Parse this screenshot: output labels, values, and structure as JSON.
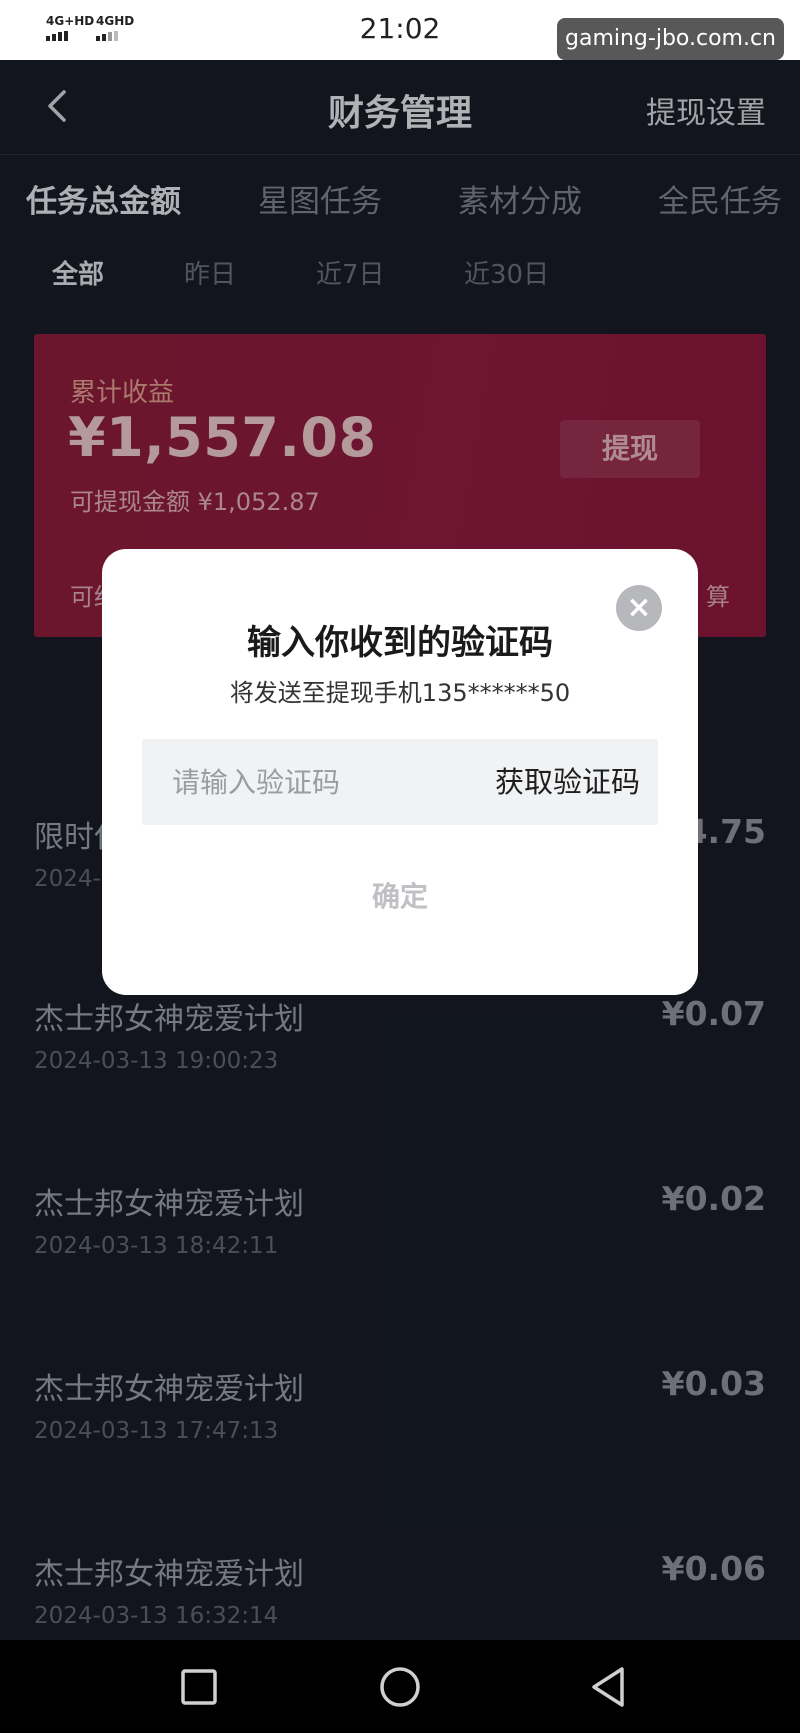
{
  "status_bar": {
    "signal_1": "4G+HD",
    "signal_2": "4GHD",
    "time": "21:02",
    "watermark": "gaming-jbo.com.cn"
  },
  "nav": {
    "title": "财务管理",
    "right_action": "提现设置"
  },
  "tabs": [
    {
      "label": "任务总金额",
      "active": true
    },
    {
      "label": "星图任务",
      "active": false
    },
    {
      "label": "素材分成",
      "active": false
    },
    {
      "label": "全民任务",
      "active": false
    }
  ],
  "filters": [
    {
      "label": "全部",
      "active": true
    },
    {
      "label": "昨日",
      "active": false
    },
    {
      "label": "近7日",
      "active": false
    },
    {
      "label": "近30日",
      "active": false
    }
  ],
  "card": {
    "label": "累计收益",
    "amount": "¥1,557.08",
    "withdrawable": "可提现金额 ¥1,052.87",
    "withdraw_button": "提现",
    "footer_left": "可结",
    "footer_right": "算"
  },
  "transactions": [
    {
      "title": "限时任",
      "time": "2024-",
      "amount": "¥4.75"
    },
    {
      "title": "杰士邦女神宠爱计划",
      "time": "2024-03-13 19:00:23",
      "amount": "¥0.07"
    },
    {
      "title": "杰士邦女神宠爱计划",
      "time": "2024-03-13 18:42:11",
      "amount": "¥0.02"
    },
    {
      "title": "杰士邦女神宠爱计划",
      "time": "2024-03-13 17:47:13",
      "amount": "¥0.03"
    },
    {
      "title": "杰士邦女神宠爱计划",
      "time": "2024-03-13 16:32:14",
      "amount": "¥0.06"
    }
  ],
  "dialog": {
    "title": "输入你收到的验证码",
    "subtitle": "将发送至提现手机135******50",
    "input_placeholder": "请输入验证码",
    "get_code": "获取验证码",
    "confirm": "确定",
    "close_glyph": "×"
  },
  "colors": {
    "background": "#151922",
    "card": "#7a1a33",
    "dialog": "#ffffff"
  },
  "icons": {
    "back": "chevron-left-icon",
    "close": "close-icon",
    "recent_apps": "square-icon",
    "home": "circle-icon",
    "back_nav": "triangle-back-icon"
  }
}
